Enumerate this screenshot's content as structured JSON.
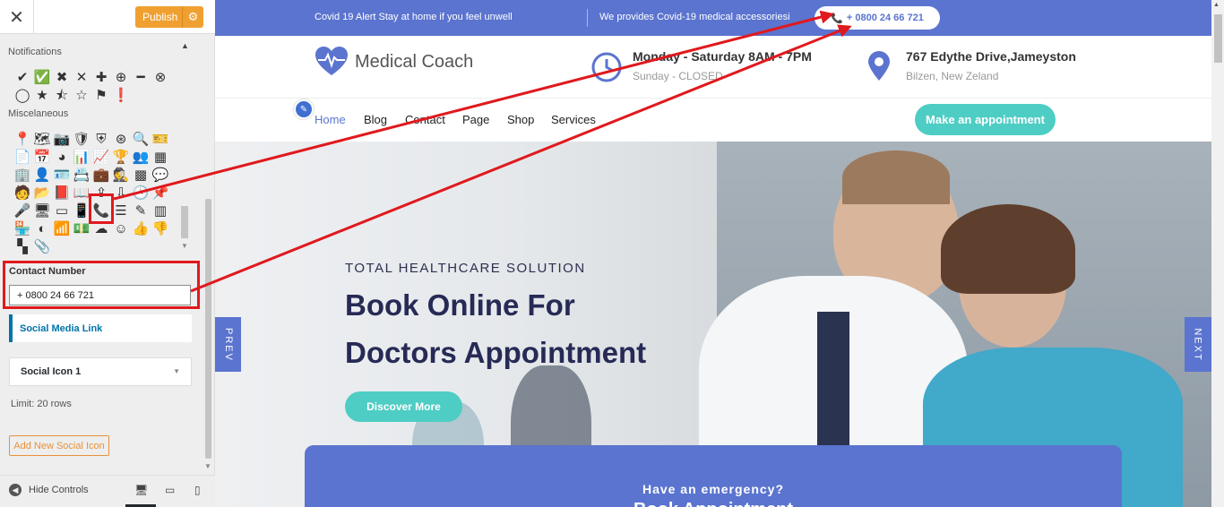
{
  "panel": {
    "close": "✕",
    "publish": "Publish",
    "gear": "⚙",
    "notifications_label": "Notifications",
    "misc_label": "Miscelaneous",
    "contact_label": "Contact Number",
    "contact_value": "+ 0800 24 66 721",
    "social_link": "Social Media Link",
    "social_icon_1": "Social Icon 1",
    "limit": "Limit: 20 rows",
    "add_social": "Add New Social Icon",
    "hide_controls": "Hide Controls"
  },
  "site": {
    "topbar": {
      "msg1": "Covid 19 Alert Stay at home if you feel unwell",
      "msg2": "We provides Covid-19 medical accessoriesi",
      "phone": "+ 0800 24 66 721"
    },
    "logo": "Medical Coach",
    "hours_title": "Monday - Saturday 8AM - 7PM",
    "hours_sub": "Sunday - CLOSED",
    "addr_title": "767 Edythe Drive,Jameyston",
    "addr_sub": "Bilzen, New Zeland",
    "nav": [
      "Home",
      "Blog",
      "Contact",
      "Page",
      "Shop",
      "Services"
    ],
    "appointment_btn": "Make an appointment",
    "hero": {
      "kicker": "TOTAL HEALTHCARE SOLUTION",
      "title_line1": "Book Online For",
      "title_line2": "Doctors Appointment",
      "button": "Discover More",
      "prev": "PREV",
      "next": "NEXT"
    },
    "emergency_title": "Have an emergency?",
    "emergency_sub": "Book Appointment"
  },
  "colors": {
    "brand_blue": "#5b74cf",
    "teal": "#4ecdc4",
    "publish_orange": "#f0a030",
    "annotation_red": "#e0191d"
  }
}
